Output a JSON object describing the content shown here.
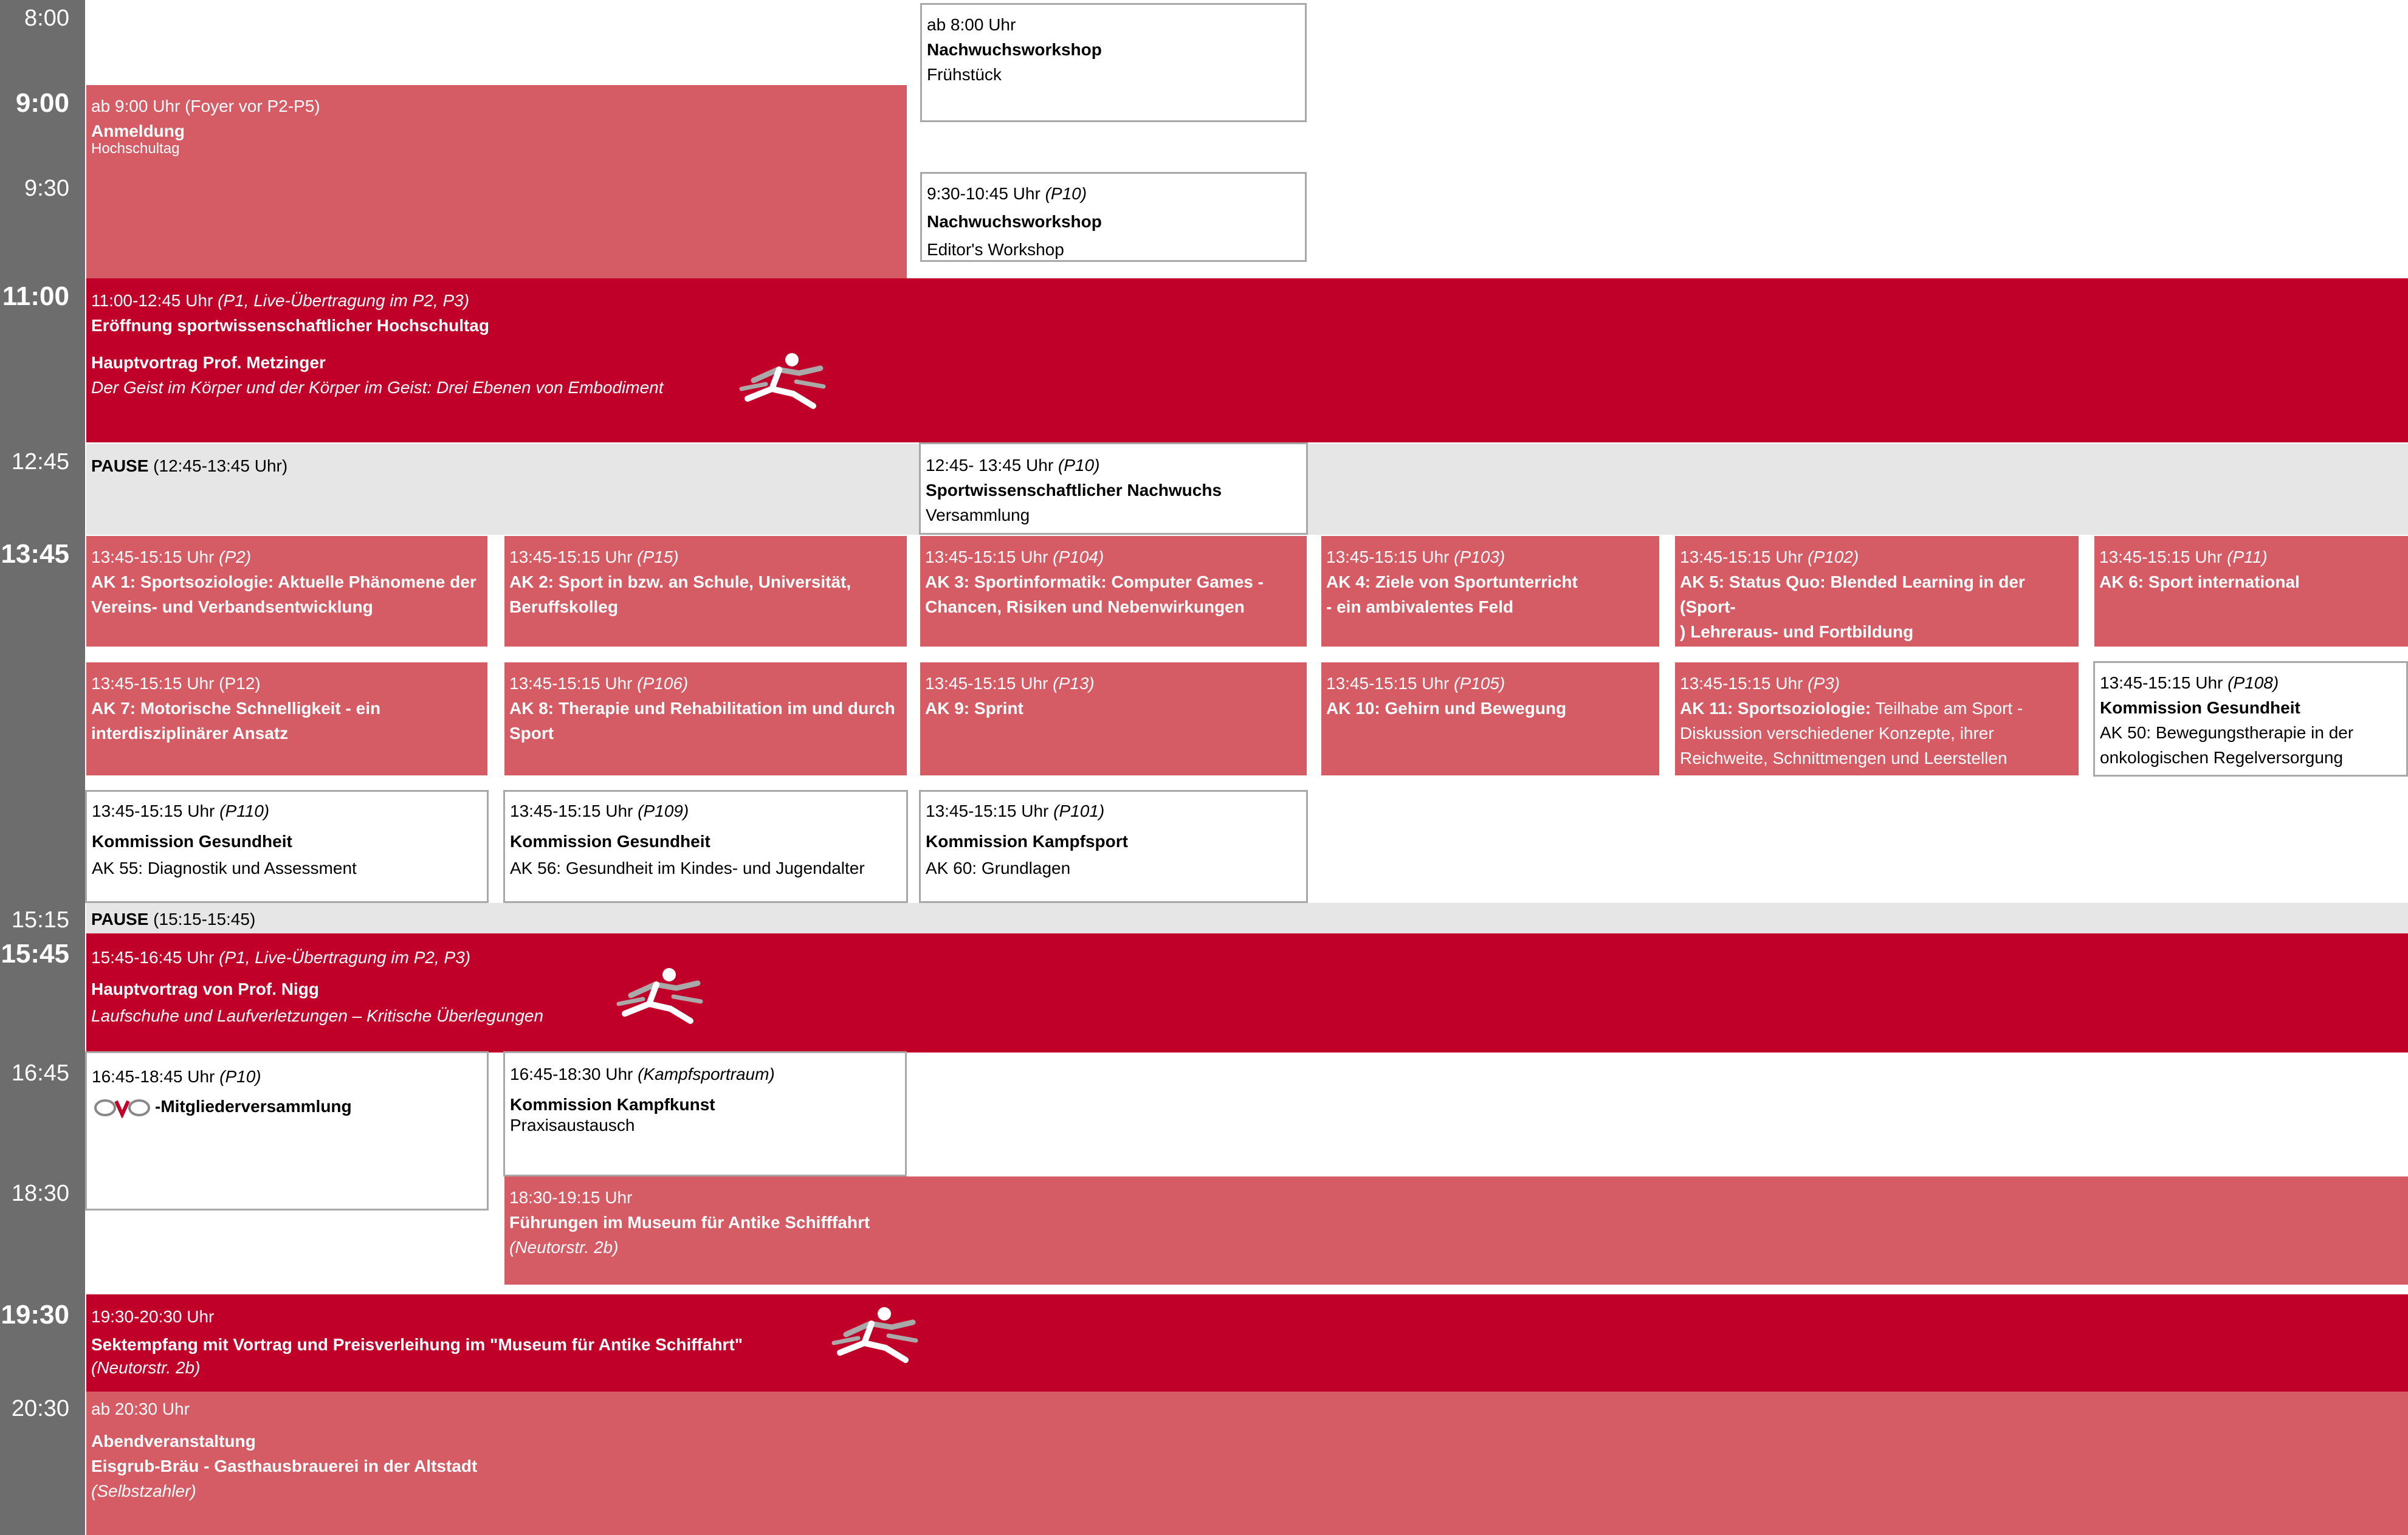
{
  "times": {
    "t800": "8:00",
    "t900": "9:00",
    "t930": "9:30",
    "t1100": "11:00",
    "t1245": "12:45",
    "t1345": "13:45",
    "t1515": "15:15",
    "t1545": "15:45",
    "t1645": "16:45",
    "t1830": "18:30",
    "t1930": "19:30",
    "t2030": "20:30"
  },
  "colors": {
    "sidebar": "#6d6d6d",
    "pink": "#d55c65",
    "red": "#c1002a",
    "grey": "#e6e6e6",
    "border": "#a8a8a8"
  },
  "events": {
    "anmeldung": {
      "time": "ab 9:00 Uhr (Foyer vor P2-P5)",
      "title": "Anmeldung",
      "sub": "Hochschultag"
    },
    "fruehstueck": {
      "time": "ab 8:00 Uhr",
      "title": "Nachwuchsworkshop",
      "sub": "Frühstück"
    },
    "editor": {
      "time": "9:30-10:45 Uhr ",
      "time_it": "(P10)",
      "title": "Nachwuchsworkshop",
      "sub": "Editor's Workshop"
    },
    "eroeffnung": {
      "time": "11:00-12:45 Uhr ",
      "time_it": "(P1, Live-Übertragung im P2, P3)",
      "title": "Eröffnung sportwissenschaftlicher Hochschultag",
      "speaker": "Hauptvortrag Prof. Metzinger",
      "talk": "Der Geist im Körper und der Körper  im Geist: Drei Ebenen von Embodiment"
    },
    "pause1": {
      "label": "PAUSE",
      "time": " (12:45-13:45 Uhr)"
    },
    "nachwuchs": {
      "time": "12:45- 13:45 Uhr ",
      "time_it": "(P10)",
      "title": "Sportwissenschaftlicher Nachwuchs",
      "sub": "Versammlung"
    },
    "ak1": {
      "time": "13:45-15:15 Uhr ",
      "room": "(P2)",
      "line1": "AK 1: Sportsoziologie: Aktuelle Phänomene der",
      "line2": "Vereins- und Verbandsentwicklung"
    },
    "ak2": {
      "time": "13:45-15:15 Uhr ",
      "room": "(P15)",
      "line1": "AK 2: Sport in bzw. an Schule, Universität,",
      "line2": "Beruffskolleg"
    },
    "ak3": {
      "time": "13:45-15:15 Uhr ",
      "room": "(P104)",
      "line1": "AK 3: Sportinformatik: Computer Games -",
      "line2": "Chancen, Risiken und Nebenwirkungen"
    },
    "ak4": {
      "time": "13:45-15:15 Uhr ",
      "room": "(P103)",
      "line1": "AK 4: Ziele von Sportunterricht",
      "line2": "- ein ambivalentes Feld"
    },
    "ak5": {
      "time": "13:45-15:15 Uhr ",
      "room": "(P102)",
      "line1": "AK 5: Status Quo: Blended Learning in der (Sport-",
      "line2": ") Lehreraus- und Fortbildung"
    },
    "ak6": {
      "time": "13:45-15:15 Uhr ",
      "room": "(P11)",
      "line1": "AK 6: Sport international"
    },
    "ak7": {
      "time": "13:45-15:15 Uhr (P12)",
      "line1": "AK 7: Motorische Schnelligkeit - ein",
      "line2": "interdisziplinärer Ansatz"
    },
    "ak8": {
      "time": "13:45-15:15 Uhr ",
      "room": "(P106)",
      "line1": "AK 8: Therapie und Rehabilitation im und durch",
      "line2": "Sport"
    },
    "ak9": {
      "time": "13:45-15:15 Uhr ",
      "room": "(P13)",
      "line1": "AK 9: Sprint"
    },
    "ak10": {
      "time": "13:45-15:15 Uhr ",
      "room": "(P105)",
      "line1": "AK 10: Gehirn und Bewegung"
    },
    "ak11": {
      "time": "13:45-15:15 Uhr ",
      "room": "(P3)",
      "line1b": "AK 11: Sportsoziologie:",
      "line1": " Teilhabe am Sport -",
      "line2": "Diskussion verschiedener Konzepte, ihrer",
      "line3": "Reichweite, Schnittmengen und Leerstellen"
    },
    "ak50": {
      "time": "13:45-15:15 Uhr ",
      "room": "(P108)",
      "title": "Kommission Gesundheit",
      "line1": "AK 50: Bewegungstherapie in der",
      "line2": "onkologischen Regelversorgung"
    },
    "ak55": {
      "time": "13:45-15:15 Uhr ",
      "room": "(P110)",
      "title": "Kommission Gesundheit",
      "line1": "AK 55: Diagnostik und Assessment"
    },
    "ak56": {
      "time": "13:45-15:15 Uhr ",
      "room": "(P109)",
      "title": "Kommission Gesundheit",
      "line1": "AK 56: Gesundheit im Kindes- und Jugendalter"
    },
    "ak60": {
      "time": "13:45-15:15 Uhr ",
      "room": "(P101)",
      "title": "Kommission Kampfsport",
      "line1": "AK 60: Grundlagen"
    },
    "pause2": {
      "label": "PAUSE",
      "time": " (15:15-15:45)"
    },
    "nigg": {
      "time": "15:45-16:45 Uhr ",
      "time_it": "(P1, Live-Übertragung im P2, P3)",
      "title": "Hauptvortrag von Prof. Nigg",
      "talk": "Laufschuhe und Laufverletzungen – Kritische Überlegungen"
    },
    "mv": {
      "time": "16:45-18:45 Uhr ",
      "time_it": "(P10)",
      "title": "-Mitgliederversammlung"
    },
    "kampfkunst": {
      "time": "16:45-18:30 Uhr ",
      "time_it": "(Kampfsportraum)",
      "title": "Kommission Kampfkunst",
      "sub": "Praxisaustausch"
    },
    "museum": {
      "time": "18:30-19:15 Uhr",
      "title": "Führungen im Museum für Antike Schifffahrt",
      "sub": "(Neutorstr. 2b)"
    },
    "sekt": {
      "time": "19:30-20:30 Uhr",
      "title": "Sektempfang mit Vortrag und Preisverleihung im \"Museum für Antike Schiffahrt\"",
      "sub": "(Neutorstr. 2b)"
    },
    "abend": {
      "time": "ab 20:30 Uhr",
      "title1": "Abendveranstaltung",
      "title2": "Eisgrub-Bräu - Gasthausbrauerei in der Altstadt",
      "sub": "(Selbstzahler)"
    }
  }
}
